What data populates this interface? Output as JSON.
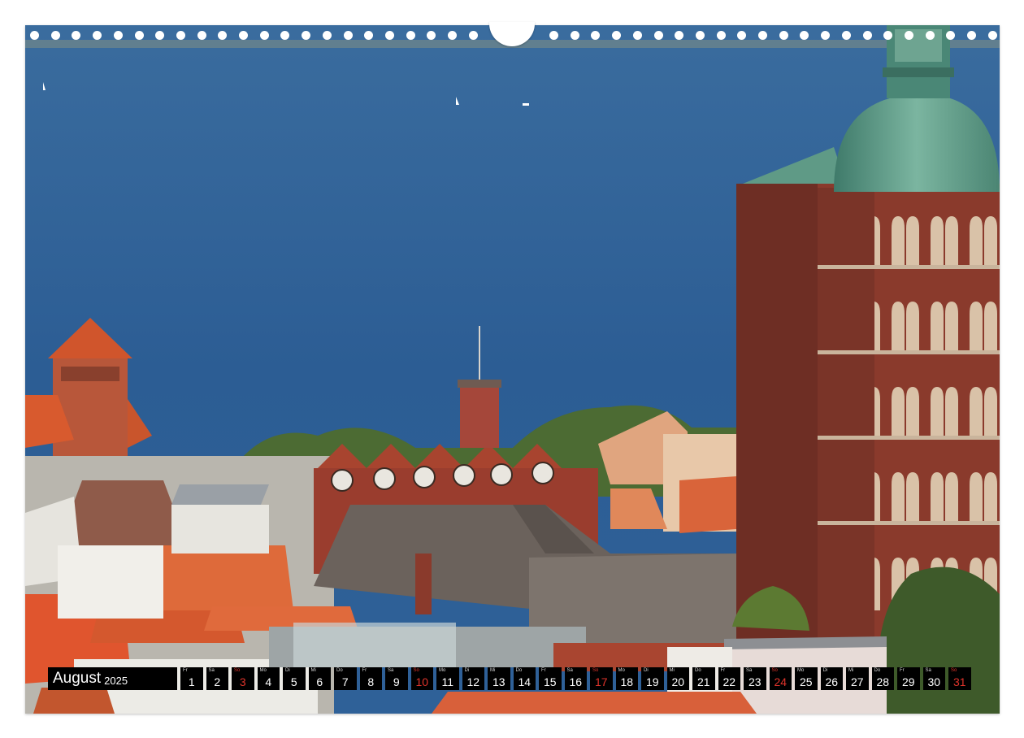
{
  "calendar": {
    "month": "August",
    "year": "2025",
    "sunday_color": "#e0342b",
    "days": [
      {
        "wd": "Fr",
        "num": "1",
        "sunday": false
      },
      {
        "wd": "Sa",
        "num": "2",
        "sunday": false
      },
      {
        "wd": "So",
        "num": "3",
        "sunday": true
      },
      {
        "wd": "Mo",
        "num": "4",
        "sunday": false
      },
      {
        "wd": "Di",
        "num": "5",
        "sunday": false
      },
      {
        "wd": "Mi",
        "num": "6",
        "sunday": false
      },
      {
        "wd": "Do",
        "num": "7",
        "sunday": false
      },
      {
        "wd": "Fr",
        "num": "8",
        "sunday": false
      },
      {
        "wd": "Sa",
        "num": "9",
        "sunday": false
      },
      {
        "wd": "So",
        "num": "10",
        "sunday": true
      },
      {
        "wd": "Mo",
        "num": "11",
        "sunday": false
      },
      {
        "wd": "Di",
        "num": "12",
        "sunday": false
      },
      {
        "wd": "Mi",
        "num": "13",
        "sunday": false
      },
      {
        "wd": "Do",
        "num": "14",
        "sunday": false
      },
      {
        "wd": "Fr",
        "num": "15",
        "sunday": false
      },
      {
        "wd": "Sa",
        "num": "16",
        "sunday": false
      },
      {
        "wd": "So",
        "num": "17",
        "sunday": true
      },
      {
        "wd": "Mo",
        "num": "18",
        "sunday": false
      },
      {
        "wd": "Di",
        "num": "19",
        "sunday": false
      },
      {
        "wd": "Mi",
        "num": "20",
        "sunday": false
      },
      {
        "wd": "Do",
        "num": "21",
        "sunday": false
      },
      {
        "wd": "Fr",
        "num": "22",
        "sunday": false
      },
      {
        "wd": "Sa",
        "num": "23",
        "sunday": false
      },
      {
        "wd": "So",
        "num": "24",
        "sunday": true
      },
      {
        "wd": "Mo",
        "num": "25",
        "sunday": false
      },
      {
        "wd": "Di",
        "num": "26",
        "sunday": false
      },
      {
        "wd": "Mi",
        "num": "27",
        "sunday": false
      },
      {
        "wd": "Do",
        "num": "28",
        "sunday": false
      },
      {
        "wd": "Fr",
        "num": "29",
        "sunday": false
      },
      {
        "wd": "Sa",
        "num": "30",
        "sunday": false
      },
      {
        "wd": "So",
        "num": "31",
        "sunday": true
      }
    ]
  },
  "colors": {
    "sea": "#2d5f96",
    "brick": "#8a3a2c",
    "roof_tiles": "#d4582e",
    "copper_dome": "#5f9a86"
  }
}
